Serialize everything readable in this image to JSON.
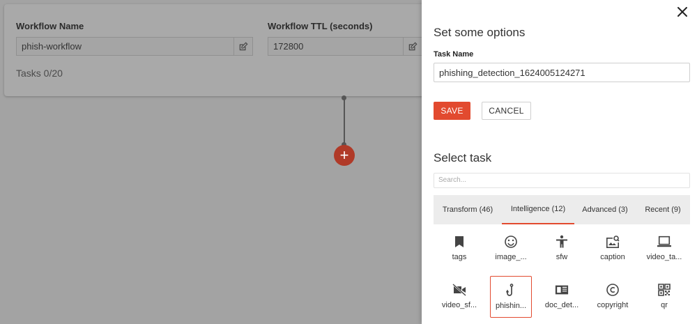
{
  "workflow": {
    "name_label": "Workflow Name",
    "name_value": "phish-workflow",
    "ttl_label": "Workflow TTL (seconds)",
    "ttl_value": "172800",
    "tasks_count": "Tasks 0/20",
    "add_node_symbol": "+"
  },
  "panel": {
    "title": "Set some options",
    "task_name_label": "Task Name",
    "task_name_value": "phishing_detection_1624005124271",
    "save_label": "SAVE",
    "cancel_label": "CANCEL",
    "select_task_title": "Select task",
    "search_placeholder": "Search...",
    "tabs": [
      {
        "label": "Transform (46)"
      },
      {
        "label": "Intelligence (12)"
      },
      {
        "label": "Advanced (3)"
      },
      {
        "label": "Recent (9)"
      }
    ],
    "active_tab": "Intelligence (12)",
    "tasks": [
      {
        "label": "tags",
        "icon": "bookmark-icon"
      },
      {
        "label": "image_...",
        "icon": "smiley-icon"
      },
      {
        "label": "sfw",
        "icon": "person-icon"
      },
      {
        "label": "caption",
        "icon": "image-caption-icon"
      },
      {
        "label": "video_ta...",
        "icon": "laptop-icon"
      },
      {
        "label": "video_sf...",
        "icon": "video-off-icon"
      },
      {
        "label": "phishin...",
        "icon": "hook-icon"
      },
      {
        "label": "doc_det...",
        "icon": "document-icon"
      },
      {
        "label": "copyright",
        "icon": "copyright-icon"
      },
      {
        "label": "qr",
        "icon": "qr-code-icon"
      }
    ],
    "selected_task": "phishin..."
  },
  "colors": {
    "accent": "#e24a2f",
    "overlay": "#a3a3a3",
    "add_node": "#b03a28"
  }
}
